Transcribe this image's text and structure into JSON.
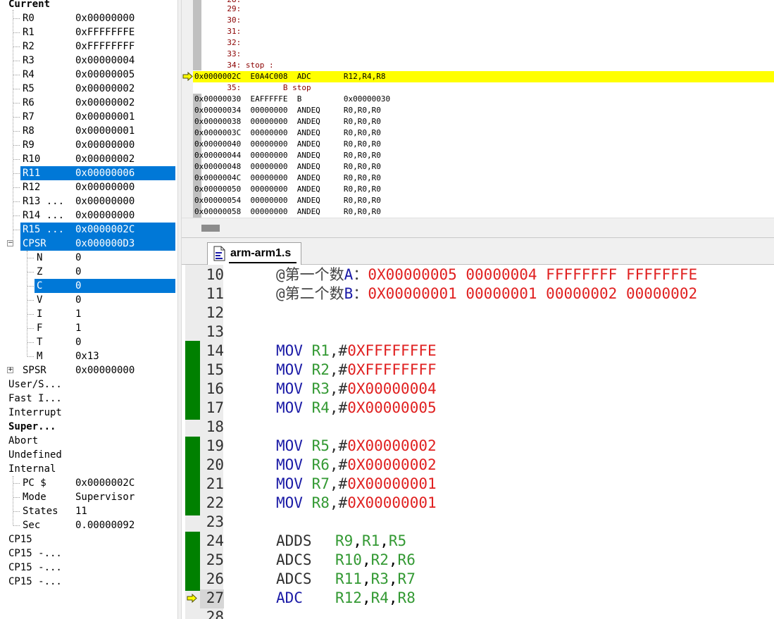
{
  "registers_panel": {
    "root_label": "Current",
    "rows": [
      {
        "name": "R0",
        "value": "0x00000000"
      },
      {
        "name": "R1",
        "value": "0xFFFFFFFE"
      },
      {
        "name": "R2",
        "value": "0xFFFFFFFF"
      },
      {
        "name": "R3",
        "value": "0x00000004"
      },
      {
        "name": "R4",
        "value": "0x00000005"
      },
      {
        "name": "R5",
        "value": "0x00000002"
      },
      {
        "name": "R6",
        "value": "0x00000002"
      },
      {
        "name": "R7",
        "value": "0x00000001"
      },
      {
        "name": "R8",
        "value": "0x00000001"
      },
      {
        "name": "R9",
        "value": "0x00000000"
      },
      {
        "name": "R10",
        "value": "0x00000002"
      },
      {
        "name": "R11",
        "value": "0x00000006"
      },
      {
        "name": "R12",
        "value": "0x00000000"
      },
      {
        "name": "R13 ...",
        "value": "0x00000000"
      },
      {
        "name": "R14 ...",
        "value": "0x00000000"
      },
      {
        "name": "R15 ...",
        "value": "0x0000002C"
      },
      {
        "name": "CPSR",
        "value": "0x000000D3"
      }
    ],
    "cpsr_flags": [
      {
        "name": "N",
        "value": "0"
      },
      {
        "name": "Z",
        "value": "0"
      },
      {
        "name": "C",
        "value": "0"
      },
      {
        "name": "V",
        "value": "0"
      },
      {
        "name": "I",
        "value": "1"
      },
      {
        "name": "F",
        "value": "1"
      },
      {
        "name": "T",
        "value": "0"
      },
      {
        "name": "M",
        "value": "0x13"
      }
    ],
    "spsr": {
      "name": "SPSR",
      "value": "0x00000000"
    },
    "modes": [
      "User/S...",
      "Fast I...",
      "Interrupt",
      "Super...",
      "Abort",
      "Undefined",
      "Internal"
    ],
    "internal": [
      {
        "name": "PC  $",
        "value": "0x0000002C"
      },
      {
        "name": "Mode",
        "value": "Supervisor"
      },
      {
        "name": "States",
        "value": "11"
      },
      {
        "name": "Sec",
        "value": "0.00000092"
      }
    ],
    "cp15": [
      "CP15",
      "CP15 -...",
      "CP15 -...",
      "CP15 -..."
    ]
  },
  "disassembly": {
    "lines": [
      {
        "kind": "src",
        "text": "       29:"
      },
      {
        "kind": "src",
        "text": "       30:"
      },
      {
        "kind": "src",
        "text": "       31:"
      },
      {
        "kind": "src",
        "text": "       32:"
      },
      {
        "kind": "src",
        "text": "       33:"
      },
      {
        "kind": "src",
        "text": "       34: stop :"
      },
      {
        "kind": "cur",
        "text": "0x0000002C  E0A4C008  ADC       R12,R4,R8"
      },
      {
        "kind": "src",
        "text": "       35:         B stop"
      },
      {
        "kind": "asm",
        "text": "0x00000030  EAFFFFFE  B         0x00000030"
      },
      {
        "kind": "asm",
        "text": "0x00000034  00000000  ANDEQ     R0,R0,R0"
      },
      {
        "kind": "asm",
        "text": "0x00000038  00000000  ANDEQ     R0,R0,R0"
      },
      {
        "kind": "asm",
        "text": "0x0000003C  00000000  ANDEQ     R0,R0,R0"
      },
      {
        "kind": "asm",
        "text": "0x00000040  00000000  ANDEQ     R0,R0,R0"
      },
      {
        "kind": "asm",
        "text": "0x00000044  00000000  ANDEQ     R0,R0,R0"
      },
      {
        "kind": "asm",
        "text": "0x00000048  00000000  ANDEQ     R0,R0,R0"
      },
      {
        "kind": "asm",
        "text": "0x0000004C  00000000  ANDEQ     R0,R0,R0"
      },
      {
        "kind": "asm",
        "text": "0x00000050  00000000  ANDEQ     R0,R0,R0"
      },
      {
        "kind": "asm",
        "text": "0x00000054  00000000  ANDEQ     R0,R0,R0"
      },
      {
        "kind": "asm",
        "text": "0x00000058  00000000  ANDEQ     R0,R0,R0"
      }
    ]
  },
  "editor": {
    "tab_label": "arm-arm1.s",
    "line_numbers": [
      "10",
      "11",
      "12",
      "13",
      "14",
      "15",
      "16",
      "17",
      "18",
      "19",
      "20",
      "21",
      "22",
      "23",
      "24",
      "25",
      "26",
      "27",
      "28"
    ],
    "comment_a": {
      "prefix": "@第一个数",
      "letter": "A",
      "colon": "：",
      "values": "0X00000005 00000004 FFFFFFFF FFFFFFFE"
    },
    "comment_b": {
      "prefix": "@第二个数",
      "letter": "B",
      "colon": "：",
      "values": "0X00000001 00000001 00000002 00000002"
    },
    "mov_lines": [
      {
        "op": "MOV",
        "reg": "R1",
        "sep": ",#",
        "imm": "0XFFFFFFFE"
      },
      {
        "op": "MOV",
        "reg": "R2",
        "sep": ",#",
        "imm": "0XFFFFFFFF"
      },
      {
        "op": "MOV",
        "reg": "R3",
        "sep": ",#",
        "imm": "0X00000004"
      },
      {
        "op": "MOV",
        "reg": "R4",
        "sep": ",#",
        "imm": "0X00000005"
      },
      {
        "op": "MOV",
        "reg": "R5",
        "sep": ",#",
        "imm": "0X00000002"
      },
      {
        "op": "MOV",
        "reg": "R6",
        "sep": ",#",
        "imm": "0X00000002"
      },
      {
        "op": "MOV",
        "reg": "R7",
        "sep": ",#",
        "imm": "0X00000001"
      },
      {
        "op": "MOV",
        "reg": "R8",
        "sep": ",#",
        "imm": "0X00000001"
      }
    ],
    "arith_lines": [
      {
        "op": "ADDS",
        "d": "R9",
        "a": "R1",
        "b": "R5"
      },
      {
        "op": "ADCS",
        "d": "R10",
        "a": "R2",
        "b": "R6"
      },
      {
        "op": "ADCS",
        "d": "R11",
        "a": "R3",
        "b": "R7"
      },
      {
        "op": "ADC",
        "d": "R12",
        "a": "R4",
        "b": "R8"
      }
    ],
    "colors": {
      "opcode": "#1a1aa6",
      "register": "#339933",
      "number": "#e02020",
      "breakpoint_bar": "#008000",
      "current_line": "#ffff00"
    }
  }
}
